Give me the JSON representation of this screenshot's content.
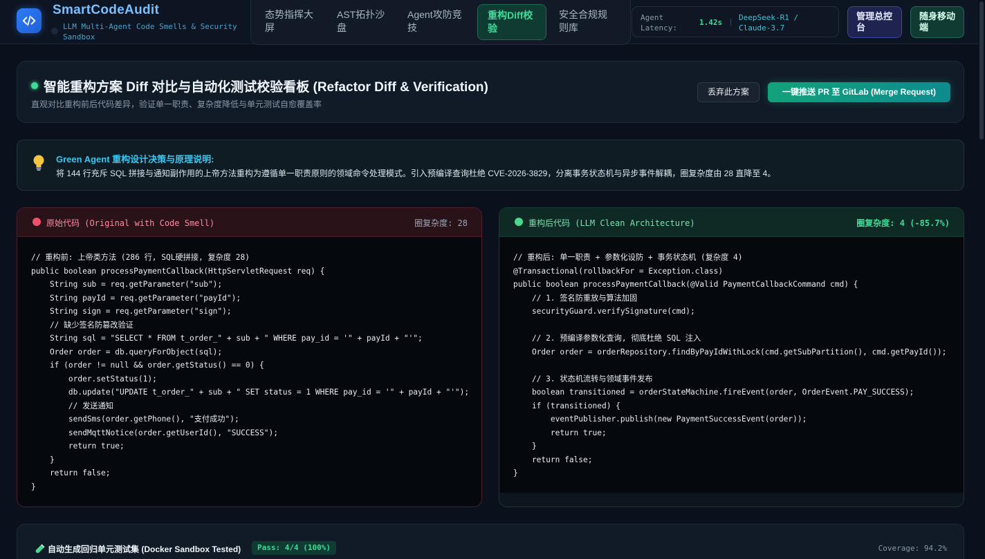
{
  "app": {
    "title": "SmartCodeAudit",
    "subtitle": "LLM Multi-Agent Code Smells & Security Sandbox"
  },
  "nav": {
    "tabs": [
      {
        "label": "态势指挥大屏",
        "active": false
      },
      {
        "label": "AST拓扑沙盘",
        "active": false
      },
      {
        "label": "Agent攻防竞技",
        "active": false
      },
      {
        "label": "重构Diff校验",
        "active": true
      },
      {
        "label": "安全合规规则库",
        "active": false
      }
    ]
  },
  "status": {
    "latency_label": "Agent Latency:",
    "latency_value": "1.42s",
    "separator": "|",
    "model": "DeepSeek-R1 / Claude-3.7"
  },
  "actions": {
    "admin_label": "管理总控台",
    "mobile_label": "随身移动端"
  },
  "header": {
    "title": "智能重构方案 Diff 对比与自动化测试校验看板 (Refactor Diff & Verification)",
    "subtitle": "直观对比重构前后代码差异，验证单一职责、复杂度降低与单元测试自愈覆盖率",
    "discard_label": "丢弃此方案",
    "push_label": "一键推送 PR 至 GitLab (Merge Request)"
  },
  "rationale": {
    "title": "Green Agent 重构设计决策与原理说明:",
    "text": "将 144 行充斥 SQL 拼接与通知副作用的上帝方法重构为遵循单一职责原则的领域命令处理模式。引入预编译查询杜绝 CVE-2026-3829，分离事务状态机与异步事件解耦，圈复杂度由 28 直降至 4。"
  },
  "original": {
    "title": "原始代码 (Original with Code Smell)",
    "metric": "圈复杂度: 28",
    "code": "// 重构前: 上帝类方法 (286 行, SQL硬拼接, 复杂度 28)\npublic boolean processPaymentCallback(HttpServletRequest req) {\n    String sub = req.getParameter(\"sub\");\n    String payId = req.getParameter(\"payId\");\n    String sign = req.getParameter(\"sign\");\n    // 缺少签名防篡改验证\n    String sql = \"SELECT * FROM t_order_\" + sub + \" WHERE pay_id = '\" + payId + \"'\";\n    Order order = db.queryForObject(sql);\n    if (order != null && order.getStatus() == 0) {\n        order.setStatus(1);\n        db.update(\"UPDATE t_order_\" + sub + \" SET status = 1 WHERE pay_id = '\" + payId + \"'\");\n        // 发送通知\n        sendSms(order.getPhone(), \"支付成功\");\n        sendMqttNotice(order.getUserId(), \"SUCCESS\");\n        return true;\n    }\n    return false;\n}"
  },
  "refactored": {
    "title": "重构后代码 (LLM Clean Architecture)",
    "metric": "圈复杂度: 4 (-85.7%)",
    "code": "// 重构后: 单一职责 + 参数化设防 + 事务状态机 (复杂度 4)\n@Transactional(rollbackFor = Exception.class)\npublic boolean processPaymentCallback(@Valid PaymentCallbackCommand cmd) {\n    // 1. 签名防重放与算法加固\n    securityGuard.verifySignature(cmd);\n\n    // 2. 预编译参数化查询, 彻底杜绝 SQL 注入\n    Order order = orderRepository.findByPayIdWithLock(cmd.getSubPartition(), cmd.getPayId());\n\n    // 3. 状态机流转与领域事件发布\n    boolean transitioned = orderStateMachine.fireEvent(order, OrderEvent.PAY_SUCCESS);\n    if (transitioned) {\n        eventPublisher.publish(new PaymentSuccessEvent(order));\n        return true;\n    }\n    return false;\n}"
  },
  "tests": {
    "title": "自动生成回归单元测试集 (Docker Sandbox Tested)",
    "badge": "Pass: 4/4 (100%)",
    "coverage": "Coverage: 94.2%"
  },
  "colors": {
    "accent_green": "#3ddc97",
    "accent_blue": "#79c0ff",
    "danger": "#f0506e"
  }
}
